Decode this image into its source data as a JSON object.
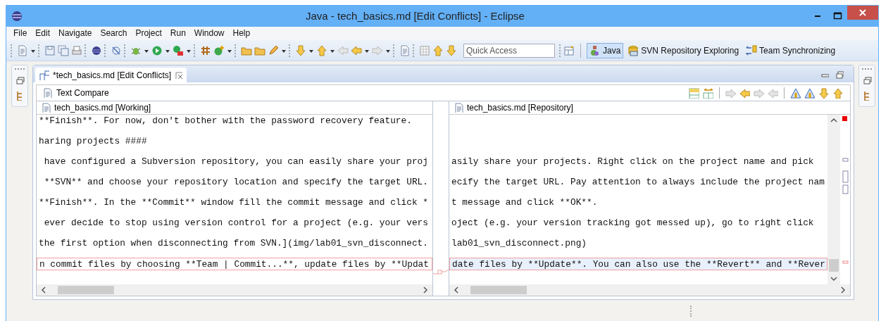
{
  "window": {
    "title": "Java - tech_basics.md [Edit Conflicts] - Eclipse"
  },
  "menu": [
    "File",
    "Edit",
    "Navigate",
    "Search",
    "Project",
    "Run",
    "Window",
    "Help"
  ],
  "quick_access": {
    "placeholder": "Quick Access"
  },
  "perspectives": [
    {
      "label": "Java",
      "selected": true
    },
    {
      "label": "SVN Repository Exploring",
      "selected": false
    },
    {
      "label": "Team Synchronizing",
      "selected": false
    }
  ],
  "editor_tab": {
    "label": "*tech_basics.md [Edit Conflicts]"
  },
  "compare": {
    "title": "Text Compare",
    "left": {
      "title": "tech_basics.md [Working]",
      "lines": [
        {
          "text": "**Finish**. For now, don't bother with the password recovery feature.",
          "conflict": false
        },
        {
          "text": "haring projects ####",
          "conflict": false
        },
        {
          "text": " have configured a Subversion repository, you can easily share your proj",
          "conflict": false
        },
        {
          "text": " **SVN** and choose your repository location and specify the target URL.",
          "conflict": false
        },
        {
          "text": "**Finish**. In the **Commit** window fill the commit message and click *",
          "conflict": false
        },
        {
          "text": " ever decide to stop using version control for a project (e.g. your vers",
          "conflict": false
        },
        {
          "text": "the first option when disconnecting from SVN.](img/lab01_svn_disconnect.",
          "conflict": false
        },
        {
          "text": "n commit files by choosing **Team | Commit...**, update files by **Updat",
          "conflict": true
        }
      ]
    },
    "right": {
      "title": "tech_basics.md [Repository]",
      "lines": [
        {
          "text": "asily share your projects. Right click on the project name and pick",
          "conflict": false
        },
        {
          "text": "ecify the target URL. Pay attention to always include the project nam",
          "conflict": false
        },
        {
          "text": "t message and click **OK**.",
          "conflict": false
        },
        {
          "text": "oject (e.g. your version tracking got messed up), go to right click",
          "conflict": false
        },
        {
          "text": "lab01_svn_disconnect.png)",
          "conflict": false
        },
        {
          "text": "date files by **Update**. You can also use the **Revert** and **Rever",
          "conflict": true
        }
      ]
    }
  }
}
